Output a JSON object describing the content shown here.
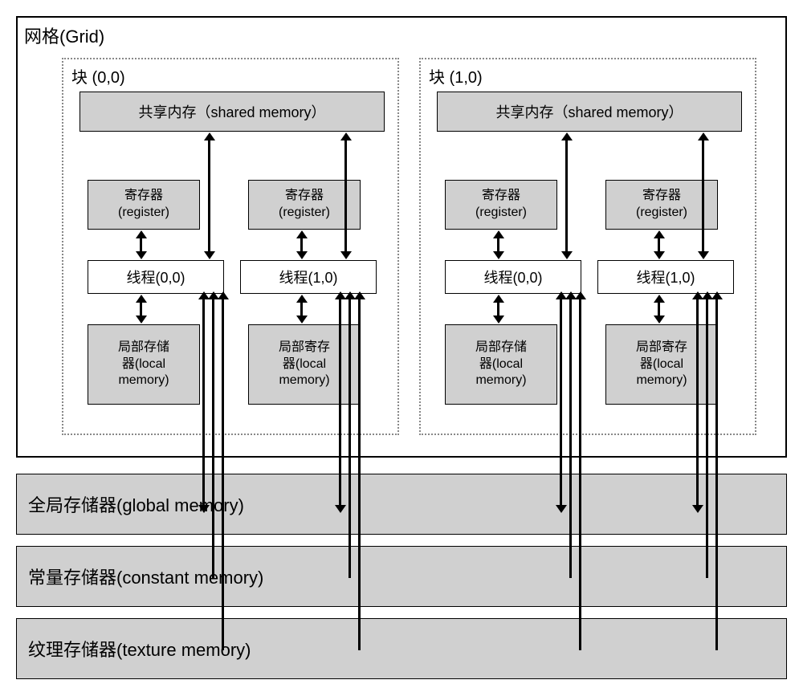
{
  "grid": {
    "label": "网格(Grid)"
  },
  "blocks": [
    {
      "label": "块 (0,0)"
    },
    {
      "label": "块 (1,0)"
    }
  ],
  "shared_memory": "共享内存（shared memory）",
  "register": {
    "cn": "寄存器",
    "en": "(register)"
  },
  "threads": [
    {
      "label": "线程(0,0)"
    },
    {
      "label": "线程(1,0)"
    }
  ],
  "local_memory": [
    {
      "l1": "局部存储",
      "l2": "器(local",
      "l3": "memory)"
    },
    {
      "l1": "局部寄存",
      "l2": "器(local",
      "l3": "memory)"
    }
  ],
  "global_memory": "全局存储器(global memory)",
  "constant_memory": "常量存储器(constant memory)",
  "texture_memory": "纹理存储器(texture memory)"
}
